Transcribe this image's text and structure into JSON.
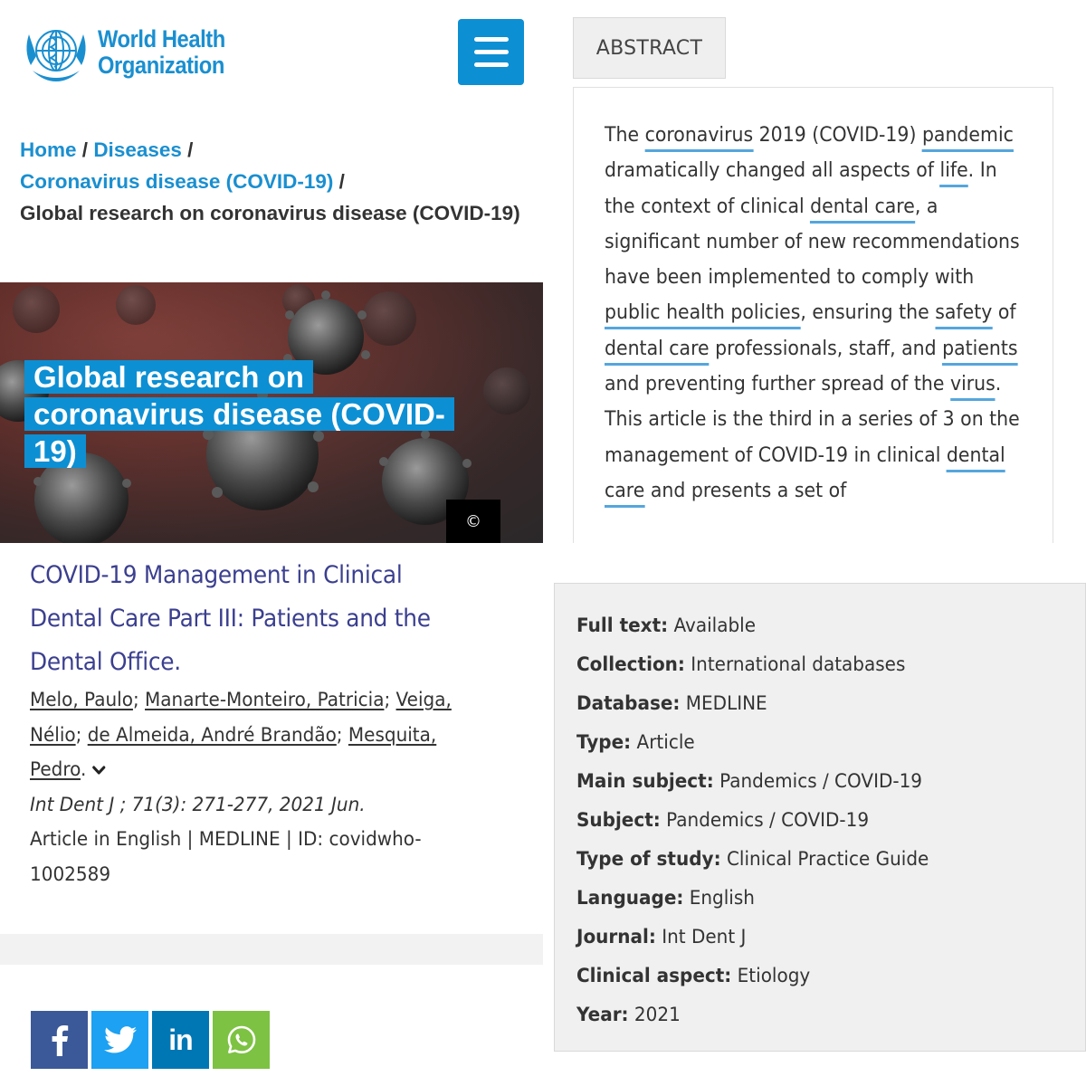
{
  "header": {
    "logo_line1": "World Health",
    "logo_line2": "Organization"
  },
  "breadcrumb": {
    "items": [
      "Home",
      "Diseases",
      "Coronavirus disease (COVID-19)"
    ],
    "current": "Global research on coronavirus disease (COVID-19)",
    "separator": "/"
  },
  "hero": {
    "title_lines": [
      "Global research on",
      "coronavirus disease (COVID-",
      "19)"
    ],
    "copyright": "©"
  },
  "article": {
    "title": "COVID-19 Management in Clinical Dental Care Part III: Patients and the Dental Office.",
    "authors": [
      "Melo, Paulo",
      "Manarte-Monteiro, Patricia",
      "Veiga, Nélio",
      "de Almeida, André Brandão",
      "Mesquita, Pedro"
    ],
    "citation": "Int Dent J ; 71(3): 271-277, 2021 Jun.",
    "meta": "Article in English | MEDLINE | ID: covidwho-1002589"
  },
  "share": {
    "buttons": [
      "facebook",
      "twitter",
      "linkedin",
      "whatsapp"
    ],
    "linkedin_label": "in"
  },
  "abstract": {
    "tab_label": "ABSTRACT",
    "segments": [
      {
        "t": "The "
      },
      {
        "t": "coronavirus",
        "kw": true
      },
      {
        "t": " 2019 (COVID-19) "
      },
      {
        "t": "pandemic",
        "kw": true
      },
      {
        "t": " dramatically changed all aspects of "
      },
      {
        "t": "life",
        "kw": true
      },
      {
        "t": ". In the context of clinical "
      },
      {
        "t": "dental care",
        "kw": true
      },
      {
        "t": ", a significant number of new recommendations have been implemented to comply with "
      },
      {
        "t": "public health policies",
        "kw": true
      },
      {
        "t": ", ensuring the "
      },
      {
        "t": "safety",
        "kw": true
      },
      {
        "t": " of "
      },
      {
        "t": "dental care",
        "kw": true
      },
      {
        "t": " professionals, staff, and "
      },
      {
        "t": "patients",
        "kw": true
      },
      {
        "t": " and preventing further spread of the "
      },
      {
        "t": "virus",
        "kw": true
      },
      {
        "t": ". This article is the third in a series of 3 on the management of COVID-19 in clinical "
      },
      {
        "t": "dental care",
        "kw": true
      },
      {
        "t": " and presents a set of"
      }
    ]
  },
  "details": {
    "rows": [
      {
        "key": "Full text:",
        "value": "Available"
      },
      {
        "key": "Collection:",
        "value": "International databases"
      },
      {
        "key": "Database:",
        "value": "MEDLINE"
      },
      {
        "key": "Type:",
        "value": "Article"
      },
      {
        "key": "Main subject:",
        "value": "Pandemics / COVID-19"
      },
      {
        "key": "Subject:",
        "value": "Pandemics / COVID-19"
      },
      {
        "key": "Type of study:",
        "value": "Clinical Practice Guide"
      },
      {
        "key": "Language:",
        "value": "English"
      },
      {
        "key": "Journal:",
        "value": "Int Dent J"
      },
      {
        "key": "Clinical aspect:",
        "value": "Etiology"
      },
      {
        "key": "Year:",
        "value": "2021"
      }
    ]
  },
  "colors": {
    "who_blue": "#1a8fd0",
    "menu_blue": "#0d8fd3",
    "title_purple": "#3b3f8f",
    "keyword_underline": "#55a6dd",
    "facebook": "#3b5998",
    "twitter": "#1da1f2",
    "linkedin": "#0077b5",
    "whatsapp": "#7dc242"
  }
}
